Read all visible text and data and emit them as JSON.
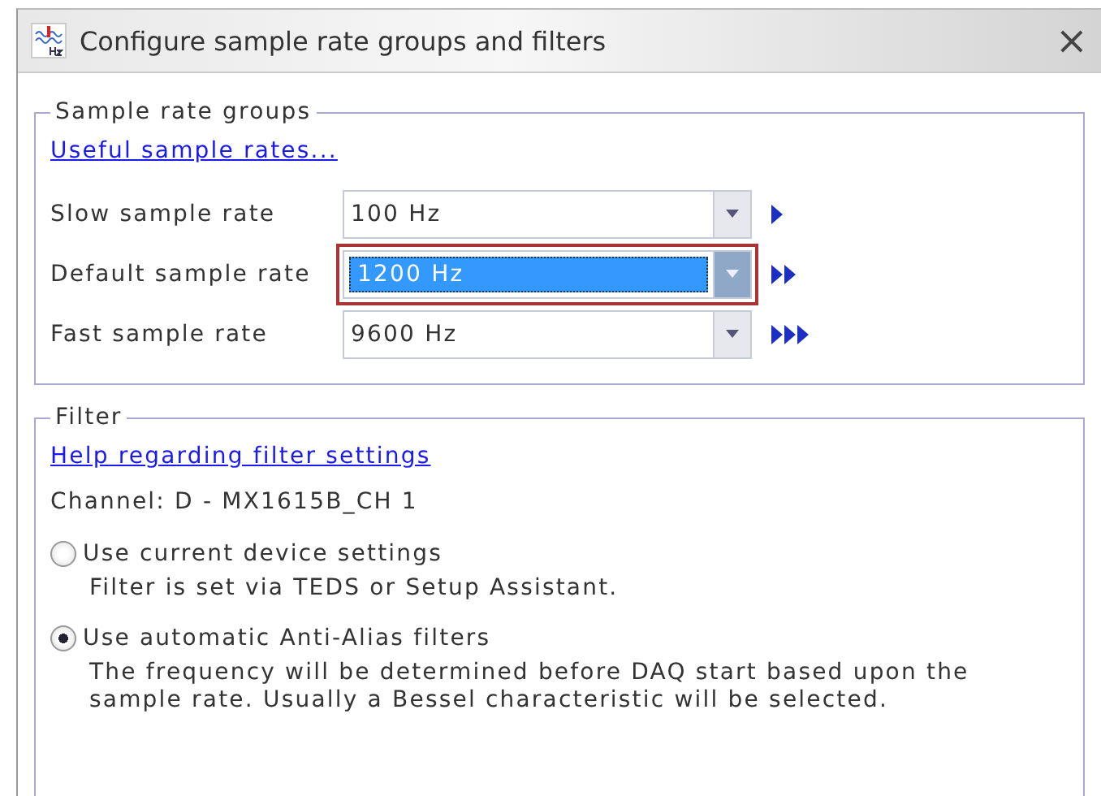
{
  "window": {
    "title": "Configure sample rate groups and filters",
    "close": "×"
  },
  "sample_rate_groups": {
    "legend": "Sample rate groups",
    "link": "Useful sample rates...",
    "rates": [
      {
        "label": "Slow sample rate",
        "value": "100 Hz",
        "focused": false
      },
      {
        "label": "Default sample rate",
        "value": "1200 Hz",
        "focused": true
      },
      {
        "label": "Fast sample rate",
        "value": "9600 Hz",
        "focused": false
      }
    ]
  },
  "filter": {
    "legend": "Filter",
    "link": "Help regarding filter settings",
    "channel": "Channel: D - MX1615B_CH 1",
    "options": [
      {
        "label": "Use current device settings",
        "description": "Filter is set via TEDS or Setup Assistant.",
        "selected": false
      },
      {
        "label": "Use automatic Anti-Alias filters",
        "description": "The frequency will be determined before DAQ start based upon the sample rate. Usually a Bessel characteristic will be selected.",
        "selected": true
      }
    ]
  }
}
